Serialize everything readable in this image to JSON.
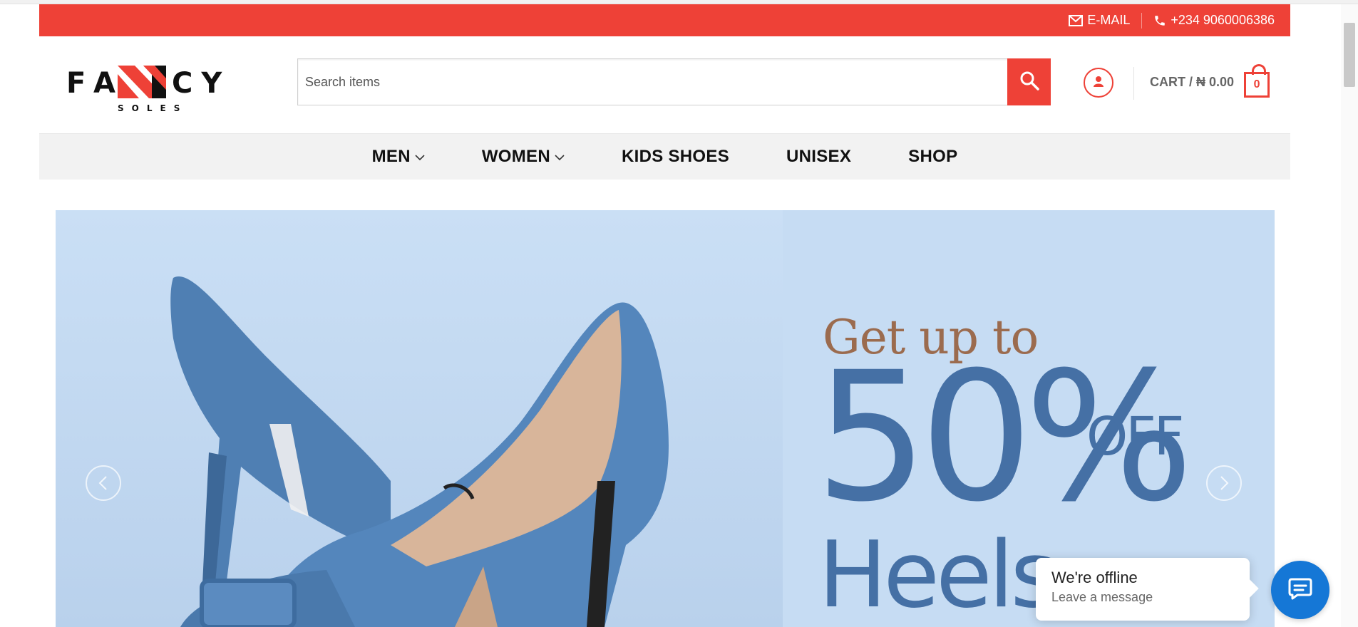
{
  "topbar": {
    "email_label": "E-MAIL",
    "phone_label": "+234 9060006386"
  },
  "logo": {
    "wordmark": "FANCY",
    "subline": "SOLES"
  },
  "search": {
    "placeholder": "Search items"
  },
  "cart": {
    "label": "CART / ₦ 0.00",
    "count": "0"
  },
  "nav": {
    "items": [
      {
        "label": "MEN",
        "has_dropdown": true
      },
      {
        "label": "WOMEN",
        "has_dropdown": true
      },
      {
        "label": "KIDS SHOES"
      },
      {
        "label": "UNISEX"
      },
      {
        "label": "SHOP"
      }
    ]
  },
  "hero": {
    "line1": "Get up to",
    "line2": "50%",
    "line3": "OFF",
    "line4": "Heels"
  },
  "chat": {
    "status": "We're offline",
    "cta": "Leave a message"
  },
  "colors": {
    "brand_red": "#ee4137",
    "chat_blue": "#1577d6",
    "hero_bg": "#c6dcf3"
  }
}
